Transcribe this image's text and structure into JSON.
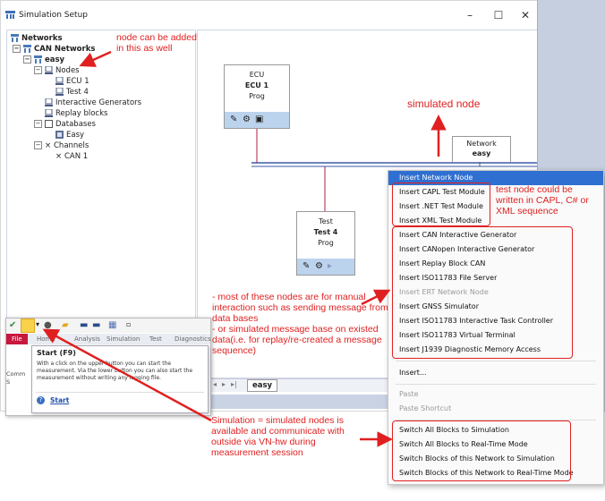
{
  "window": {
    "title": "Simulation Setup",
    "minimize_glyph": "–",
    "maximize_glyph": "☐",
    "close_glyph": "✕"
  },
  "tree": {
    "root": "Networks",
    "can_networks": "CAN Networks",
    "network": "easy",
    "nodes": "Nodes",
    "node_items": [
      "ECU 1",
      "Test 4"
    ],
    "interactive_generators": "Interactive Generators",
    "replay_blocks": "Replay blocks",
    "databases": "Databases",
    "database_items": [
      "Easy"
    ],
    "channels": "Channels",
    "channel_items": [
      "CAN 1"
    ]
  },
  "canvas": {
    "ecu_node": {
      "type": "ECU",
      "name": "ECU 1",
      "mode": "Prog"
    },
    "test_node": {
      "type": "Test",
      "name": "Test 4",
      "mode": "Prog"
    },
    "network_node": {
      "type": "Network",
      "name": "easy"
    },
    "tab_label": "easy"
  },
  "context_menu": {
    "items": [
      {
        "label": "Insert Network Node",
        "state": "highlighted"
      },
      {
        "label": "Insert CAPL Test Module",
        "state": "normal"
      },
      {
        "label": "Insert .NET Test Module",
        "state": "normal"
      },
      {
        "label": "Insert XML Test Module",
        "state": "normal"
      },
      {
        "label": "Insert CAN Interactive Generator",
        "state": "normal"
      },
      {
        "label": "Insert CANopen Interactive Generator",
        "state": "normal"
      },
      {
        "label": "Insert Replay Block CAN",
        "state": "normal"
      },
      {
        "label": "Insert ISO11783 File Server",
        "state": "normal"
      },
      {
        "label": "Insert ERT Network Node",
        "state": "disabled"
      },
      {
        "label": "Insert GNSS Simulator",
        "state": "normal"
      },
      {
        "label": "Insert ISO11783 Interactive Task Controller",
        "state": "normal"
      },
      {
        "label": "Insert ISO11783 Virtual Terminal",
        "state": "normal"
      },
      {
        "label": "Insert J1939 Diagnostic Memory Access",
        "state": "normal"
      },
      {
        "label": "Insert...",
        "state": "normal"
      },
      {
        "label": "Paste",
        "state": "disabled"
      },
      {
        "label": "Paste Shortcut",
        "state": "disabled"
      },
      {
        "label": "Switch All Blocks to Simulation",
        "state": "normal"
      },
      {
        "label": "Switch All Blocks to Real-Time Mode",
        "state": "normal"
      },
      {
        "label": "Switch Blocks of this Network to Simulation",
        "state": "normal"
      },
      {
        "label": "Switch Blocks of this Network to Real-Time Mode",
        "state": "normal"
      }
    ]
  },
  "inset": {
    "tabs": [
      "File",
      "Home",
      "Analysis",
      "Simulation",
      "Test",
      "Diagnostics"
    ],
    "tooltip_title": "Start (F9)",
    "tooltip_body": "With a click on the upper button you can start the measurement. Via the lower button you can also start the measurement without writing any logging file.",
    "tooltip_link": "Start",
    "left_fragment": "Comm S"
  },
  "annotations": {
    "node_added": "node can be added in this as well",
    "simulated_node": "simulated node",
    "test_node_written": "test node could be written in CAPL, C# or XML sequence",
    "manual_interaction": "- most of these nodes are for manual interaction such as sending message from data bases\n- or simulated message base on existed data(i.e. for replay/re-created a message sequence)",
    "simulation_note": "Simulation = simulated nodes is available and communicate with outside via VN-hw during measurement session"
  },
  "colors": {
    "annotation_red": "#e02020",
    "menu_highlight": "#2f6fd1",
    "toolbar_blue": "#bcd3ee"
  }
}
